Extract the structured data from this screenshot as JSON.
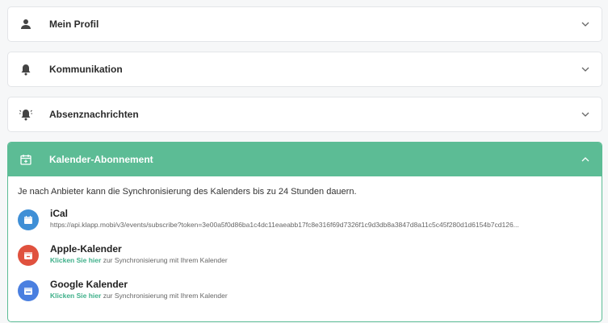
{
  "sections": [
    {
      "title": "Mein Profil",
      "icon": "person-icon"
    },
    {
      "title": "Kommunikation",
      "icon": "bell-icon"
    },
    {
      "title": "Absenznachrichten",
      "icon": "bell-ringing-icon"
    }
  ],
  "calendar": {
    "title": "Kalender-Abonnement",
    "intro": "Je nach Anbieter kann die Synchronisierung des Kalenders bis zu 24 Stunden dauern.",
    "items": [
      {
        "name": "iCal",
        "url": "https://api.klapp.mobi/v3/events/subscribe?token=3e00a5f0d86ba1c4dc11eaeabb17fc8e316f69d7326f1c9d3db8a3847d8a11c5c45f280d1d6154b7cd126...",
        "color": "#3f8fd6"
      },
      {
        "name": "Apple-Kalender",
        "link_text": "Klicken Sie hier",
        "link_suffix": "zur Synchronisierung mit Ihrem Kalender",
        "color": "#e0513e"
      },
      {
        "name": "Google Kalender",
        "link_text": "Klicken Sie hier",
        "link_suffix": "zur Synchronisierung mit Ihrem Kalender",
        "color": "#4a7fe0"
      }
    ]
  },
  "colors": {
    "accent": "#5cbc95",
    "link": "#3fb08a"
  }
}
